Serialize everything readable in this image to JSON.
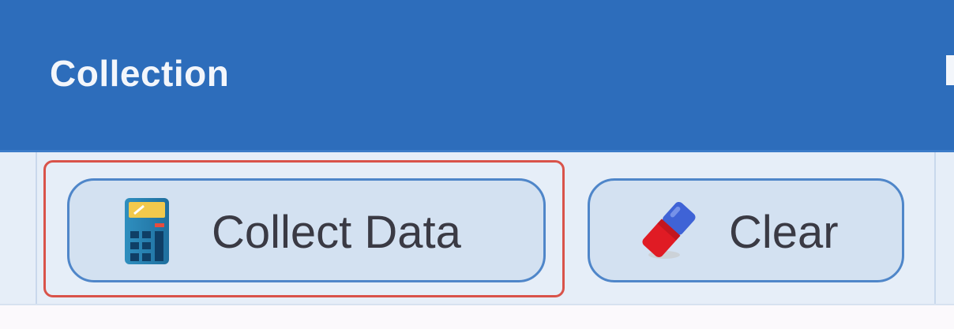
{
  "ribbon": {
    "group_title": "Collection",
    "buttons": [
      {
        "label": "Collect Data",
        "icon": "calculator-icon"
      },
      {
        "label": "Clear",
        "icon": "eraser-icon"
      }
    ]
  },
  "colors": {
    "header": "#2d6dbb",
    "body": "#e6eef8",
    "button_fill": "#d3e1f1",
    "button_border": "#4f86c9",
    "focus_ring": "#d9534a"
  }
}
